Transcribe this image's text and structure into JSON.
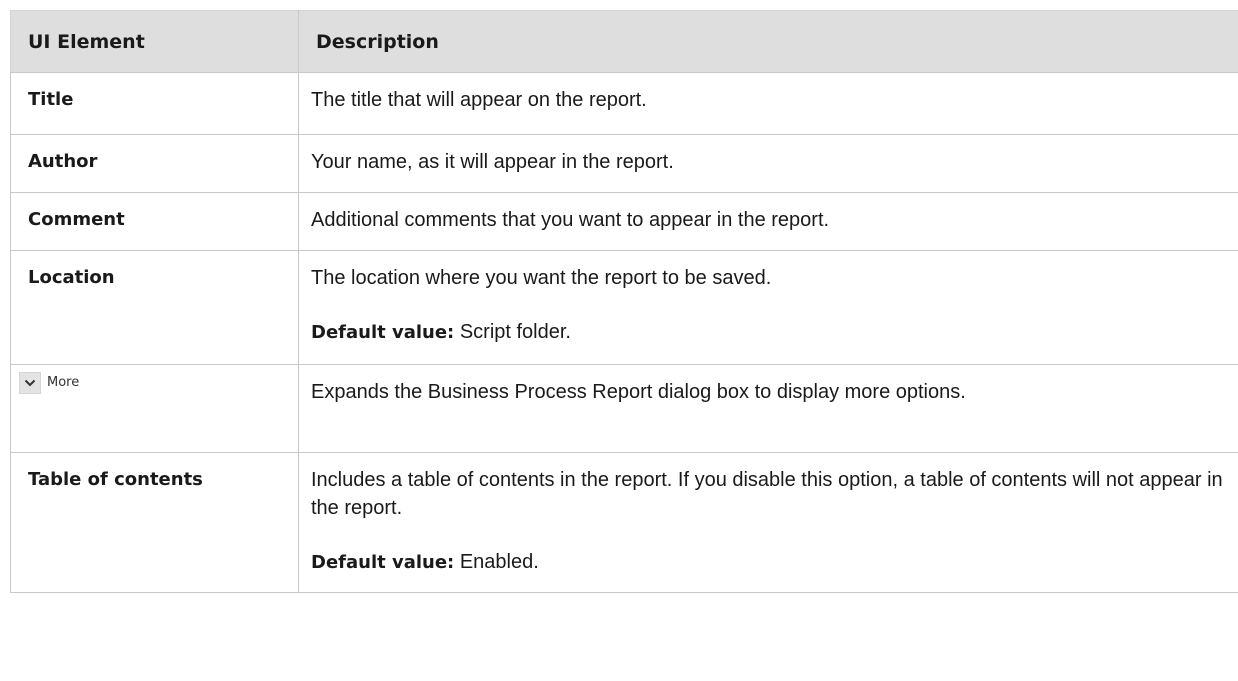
{
  "table": {
    "headers": {
      "element": "UI Element",
      "description": "Description"
    },
    "rows": [
      {
        "element": "Title",
        "description": "The title that will appear on the report."
      },
      {
        "element": "Author",
        "description": "Your name, as it will appear in the report."
      },
      {
        "element": "Comment",
        "description": "Additional comments that you want to appear in the report."
      },
      {
        "element": "Location",
        "description": "The location where you want the report to be saved.",
        "default_label": "Default value:",
        "default_value": " Script folder."
      },
      {
        "element_widget": {
          "icon": "chevron-down-icon",
          "label": "More"
        },
        "description": "Expands the Business Process Report dialog box to display more options."
      },
      {
        "element": "Table of contents",
        "description": "Includes a table of contents in the report. If you disable this option, a table of contents will not appear in the report.",
        "default_label": "Default value:",
        "default_value": " Enabled."
      }
    ]
  }
}
